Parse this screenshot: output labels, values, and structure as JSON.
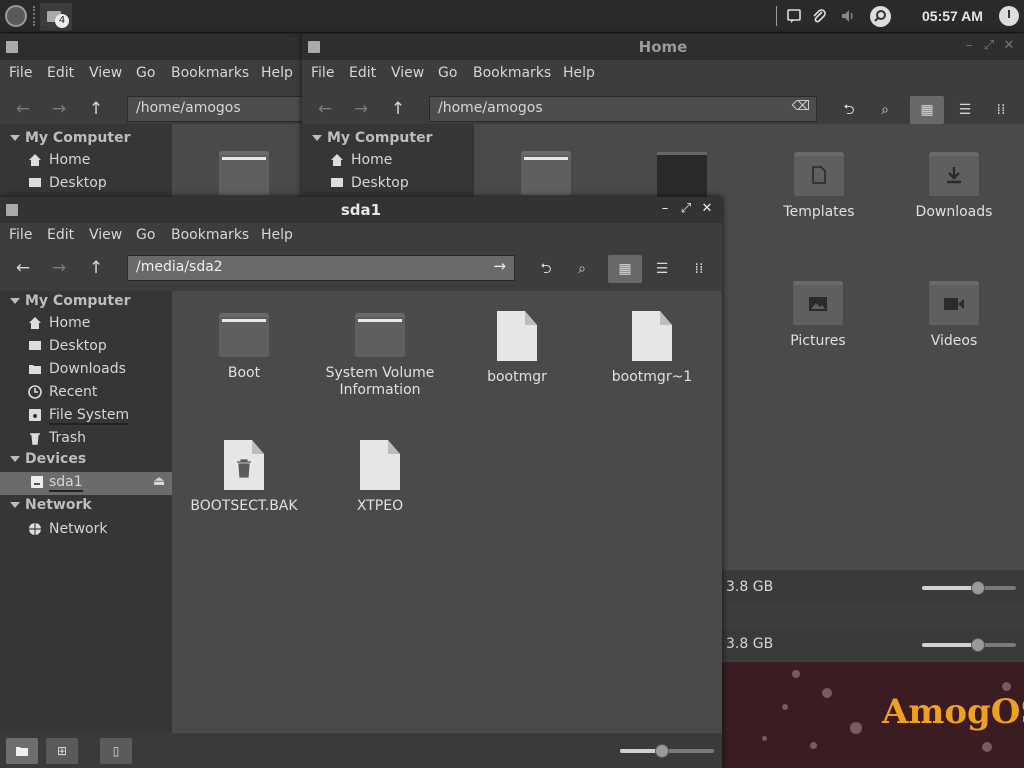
{
  "panel": {
    "workspace_badge": "4",
    "clock": "05:57 AM"
  },
  "menus": [
    "File",
    "Edit",
    "View",
    "Go",
    "Bookmarks",
    "Help"
  ],
  "window_back": {
    "title": "",
    "location": "/home/amogos",
    "sidebar": {
      "my_computer": "My Computer",
      "items": [
        {
          "label": "Home",
          "icon": "home-icon"
        },
        {
          "label": "Desktop",
          "icon": "desktop-icon"
        }
      ]
    }
  },
  "window_home": {
    "title": "Home",
    "location": "/home/amogos",
    "sidebar": {
      "my_computer": "My Computer",
      "items": [
        {
          "label": "Home",
          "icon": "home-icon"
        },
        {
          "label": "Desktop",
          "icon": "desktop-icon"
        }
      ]
    },
    "files": [
      {
        "name": "Templates",
        "icon": "template-folder-icon"
      },
      {
        "name": "Downloads",
        "icon": "download-folder-icon"
      },
      {
        "name": "Pictures",
        "icon": "pictures-folder-icon"
      },
      {
        "name": "Videos",
        "icon": "videos-folder-icon"
      }
    ],
    "status_free": "3.8 GB",
    "status_free_2": "3.8 GB",
    "zoom_level": 0.6
  },
  "window_sda1": {
    "title": "sda1",
    "location": "/media/sda2",
    "sidebar": {
      "my_computer": "My Computer",
      "my_computer_items": [
        {
          "label": "Home",
          "icon": "home-icon"
        },
        {
          "label": "Desktop",
          "icon": "desktop-icon"
        },
        {
          "label": "Downloads",
          "icon": "folder-icon"
        },
        {
          "label": "Recent",
          "icon": "recent-icon"
        },
        {
          "label": "File System",
          "icon": "drive-icon"
        },
        {
          "label": "Trash",
          "icon": "trash-icon"
        }
      ],
      "devices": "Devices",
      "device_items": [
        {
          "label": "sda1",
          "icon": "drive-icon"
        }
      ],
      "network": "Network",
      "network_items": [
        {
          "label": "Network",
          "icon": "network-icon"
        }
      ]
    },
    "files": [
      {
        "name": "Boot",
        "kind": "folder"
      },
      {
        "name": "System Volume Information",
        "kind": "folder"
      },
      {
        "name": "bootmgr",
        "kind": "file"
      },
      {
        "name": "bootmgr~1",
        "kind": "file"
      },
      {
        "name": "BOOTSECT.BAK",
        "kind": "file-trash"
      },
      {
        "name": "XTPEO",
        "kind": "file"
      }
    ],
    "zoom_level": 0.45
  },
  "wallpaper": {
    "brand": "AmogOS"
  }
}
